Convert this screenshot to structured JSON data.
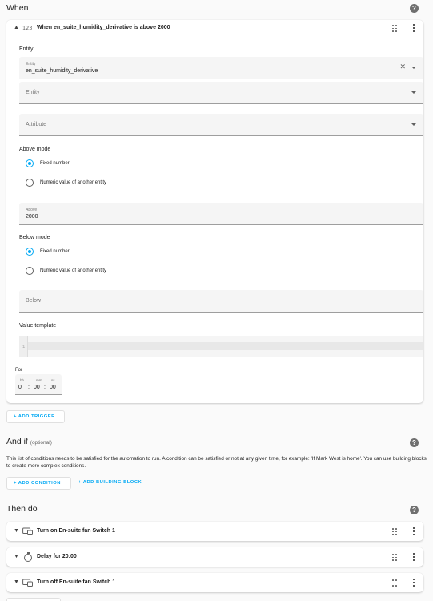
{
  "when": {
    "title": "When",
    "trigger": {
      "heading": "When en_suite_humidity_derivative is above 2000",
      "type_icon": "123",
      "entity_label": "Entity",
      "entity_field_small": "Entity",
      "entity_value": "en_suite_humidity_derivative",
      "entity2_placeholder": "Entity",
      "attribute_placeholder": "Attribute",
      "above_mode_label": "Above mode",
      "above_options": [
        "Fixed number",
        "Numeric value of another entity"
      ],
      "above_small": "Above",
      "above_value": "2000",
      "below_mode_label": "Below mode",
      "below_options": [
        "Fixed number",
        "Numeric value of another entity"
      ],
      "below_placeholder": "Below",
      "value_template_label": "Value template",
      "code_line": "1",
      "for_label": "For",
      "duration": {
        "hh_label": "hh",
        "mm_label": "mm",
        "ss_label": "ss",
        "hh": "0",
        "mm": "00",
        "ss": "00",
        "sep": ":"
      }
    },
    "add_trigger": "+ ADD TRIGGER"
  },
  "and_if": {
    "title": "And if",
    "optional": "(optional)",
    "description": "This list of conditions needs to be satisfied for the automation to run. A condition can be satisfied or not at any given time, for example: 'If Mark West is home'. You can use building blocks to create more complex conditions.",
    "add_condition": "+ ADD CONDITION",
    "add_building_block": "+ ADD BUILDING BLOCK"
  },
  "then_do": {
    "title": "Then do",
    "actions": [
      {
        "label": "Turn on En-suite fan Switch 1",
        "icon": "switch-icon"
      },
      {
        "label": "Delay for 20:00",
        "icon": "stopwatch-icon"
      },
      {
        "label": "Turn off En-suite fan Switch 1",
        "icon": "switch-icon"
      }
    ]
  },
  "help_symbol": "?",
  "colors": {
    "accent": "#03a9f4",
    "background": "#fafafa",
    "card": "#ffffff",
    "field": "#f5f5f5"
  }
}
